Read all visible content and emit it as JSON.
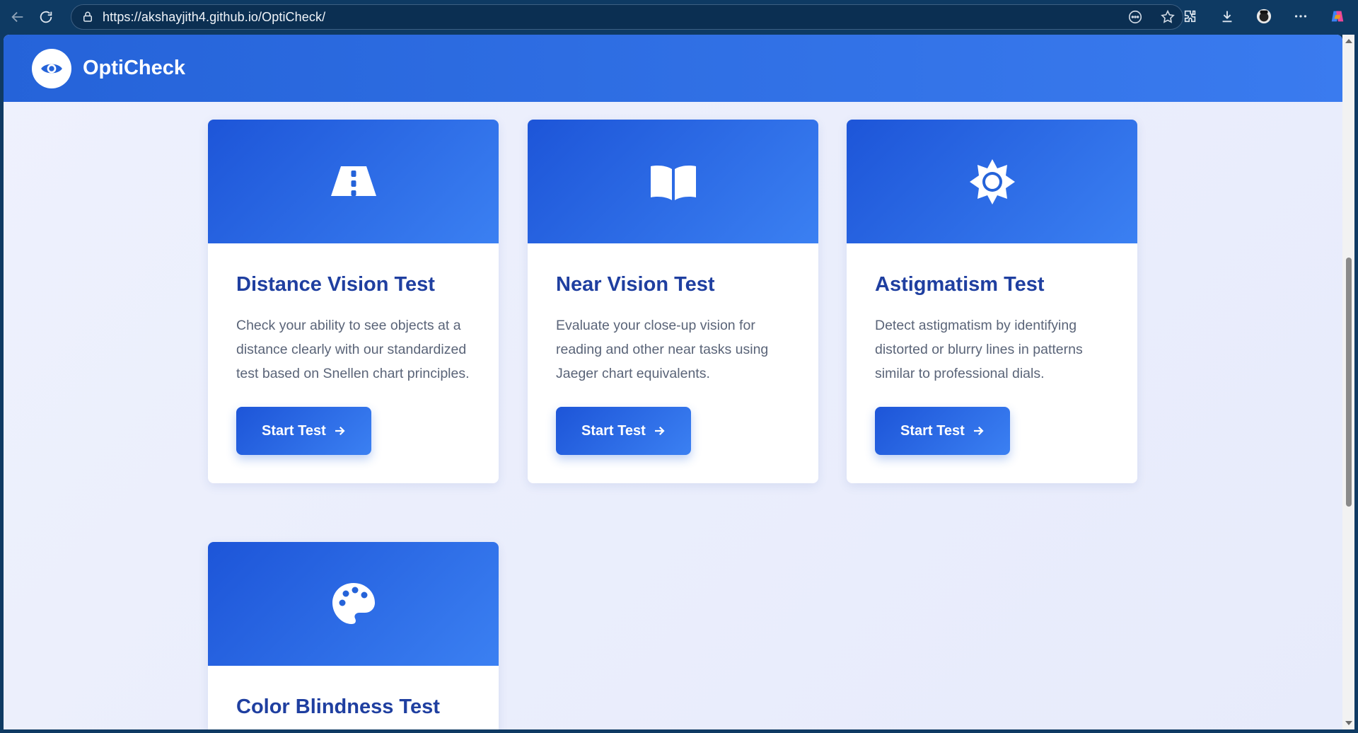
{
  "browser": {
    "url": "https://akshayjith4.github.io/OptiCheck/"
  },
  "app": {
    "brand": "OptiCheck",
    "logo_icon": "eye-icon",
    "accent_color": "#2563d9"
  },
  "cards": [
    {
      "icon": "road-icon",
      "title": "Distance Vision Test",
      "description": "Check your ability to see objects at a distance clearly with our standardized test based on Snellen chart principles.",
      "button_label": "Start Test"
    },
    {
      "icon": "book-open-icon",
      "title": "Near Vision Test",
      "description": "Evaluate your close-up vision for reading and other near tasks using Jaeger chart equivalents.",
      "button_label": "Start Test"
    },
    {
      "icon": "sun-icon",
      "title": "Astigmatism Test",
      "description": "Detect astigmatism by identifying distorted or blurry lines in patterns similar to professional dials.",
      "button_label": "Start Test"
    },
    {
      "icon": "palette-icon",
      "title": "Color Blindness Test"
    }
  ]
}
